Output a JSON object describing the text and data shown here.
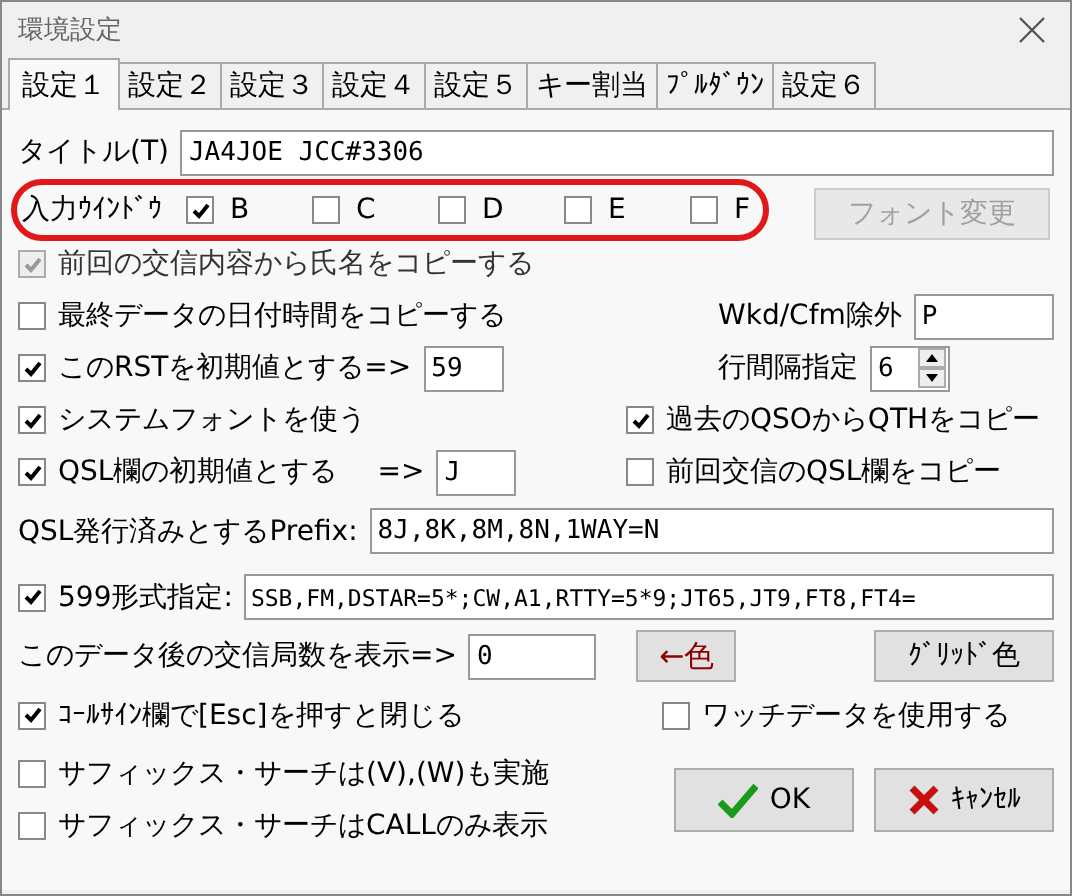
{
  "window": {
    "title": "環境設定"
  },
  "tabs": [
    {
      "label": "設定１",
      "selected": true
    },
    {
      "label": "設定２",
      "selected": false
    },
    {
      "label": "設定３",
      "selected": false
    },
    {
      "label": "設定４",
      "selected": false
    },
    {
      "label": "設定５",
      "selected": false
    },
    {
      "label": "キー割当",
      "selected": false
    },
    {
      "label": "ﾌﾟﾙﾀﾞｳﾝ",
      "selected": false
    },
    {
      "label": "設定６",
      "selected": false
    }
  ],
  "title_field": {
    "label": "タイトル(T)",
    "value": "JA4JOE JCC#3306"
  },
  "input_window": {
    "label": "入力ｳｲﾝﾄﾞｳ",
    "highlighted": true,
    "options": [
      {
        "label": "B",
        "checked": true
      },
      {
        "label": "C",
        "checked": false
      },
      {
        "label": "D",
        "checked": false
      },
      {
        "label": "E",
        "checked": false
      },
      {
        "label": "F",
        "checked": false
      }
    ]
  },
  "font_button": {
    "label": "フォント変更",
    "disabled": true
  },
  "copy_name": {
    "label": "前回の交信内容から氏名をコピーする",
    "checked": true,
    "disabled": true
  },
  "copy_datetime": {
    "label": "最終データの日付時間をコピーする",
    "checked": false
  },
  "wkd_cfm": {
    "label": "Wkd/Cfm除外",
    "value": "P"
  },
  "rst_default": {
    "label": "このRSTを初期値とする=>",
    "checked": true,
    "value": "59"
  },
  "line_spacing": {
    "label": "行間隔指定",
    "value": "6"
  },
  "system_font": {
    "label": "システムフォントを使う",
    "checked": true
  },
  "copy_qth": {
    "label": "過去のQSOからQTHをコピー",
    "checked": true
  },
  "qsl_default": {
    "label": "QSL欄の初期値とする",
    "arrow": "=>",
    "checked": true,
    "value": "J"
  },
  "copy_qsl": {
    "label": "前回交信のQSL欄をコピー",
    "checked": false
  },
  "qsl_prefix": {
    "label": "QSL発行済みとするPrefix:",
    "value": "8J,8K,8M,8N,1WAY=N"
  },
  "format_599": {
    "label": "599形式指定:",
    "checked": true,
    "value": "SSB,FM,DSTAR=5*;CW,A1,RTTY=5*9;JT65,JT9,FT8,FT4="
  },
  "count_after": {
    "label": "このデータ後の交信局数を表示=>",
    "value": "0"
  },
  "color_button": {
    "label": "←色",
    "color": "#8b0000"
  },
  "grid_color_button": {
    "label": "ｸﾞﾘｯﾄﾞ色"
  },
  "esc_close": {
    "label": "ｺｰﾙｻｲﾝ欄で[Esc]を押すと閉じる",
    "checked": true
  },
  "watch_data": {
    "label": "ワッチデータを使用する",
    "checked": false
  },
  "suffix_vw": {
    "label": "サフィックス・サーチは(V),(W)も実施",
    "checked": false
  },
  "suffix_call": {
    "label": "サフィックス・サーチはCALLのみ表示",
    "checked": false
  },
  "ok_button": {
    "label": "OK"
  },
  "cancel_button": {
    "label": "ｷｬﾝｾﾙ"
  }
}
